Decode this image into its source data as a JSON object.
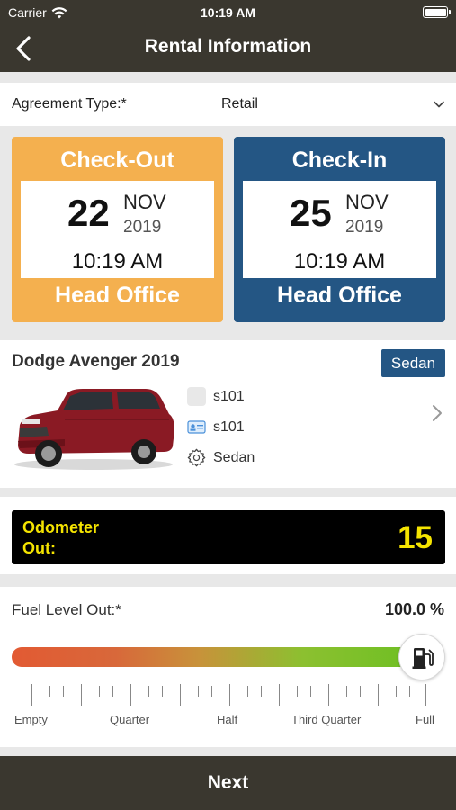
{
  "status_bar": {
    "carrier": "Carrier",
    "time": "10:19 AM"
  },
  "header": {
    "title": "Rental Information",
    "back_icon": "chevron-left-icon"
  },
  "agreement": {
    "label": "Agreement Type:*",
    "value": "Retail"
  },
  "checkout": {
    "title": "Check-Out",
    "day": "22",
    "month": "NOV",
    "year": "2019",
    "time": "10:19 AM",
    "location": "Head Office",
    "color": "#f4b04f"
  },
  "checkin": {
    "title": "Check-In",
    "day": "25",
    "month": "NOV",
    "year": "2019",
    "time": "10:19 AM",
    "location": "Head Office",
    "color": "#245684"
  },
  "vehicle": {
    "name": "Dodge Avenger 2019",
    "type_badge": "Sedan",
    "specs": [
      {
        "icon": "square-placeholder-icon",
        "text": "s101"
      },
      {
        "icon": "id-card-icon",
        "text": "s101"
      },
      {
        "icon": "gear-icon",
        "text": "Sedan"
      }
    ]
  },
  "odometer": {
    "label": "Odometer Out:",
    "value": "15"
  },
  "fuel": {
    "label": "Fuel Level Out:*",
    "percent_text": "100.0 %",
    "level_fraction": 1.0,
    "scale_labels": [
      "Empty",
      "Quarter",
      "Half",
      "Third Quarter",
      "Full"
    ]
  },
  "footer": {
    "next_label": "Next"
  },
  "colors": {
    "bar": "#3a372f",
    "accent_orange": "#f4b04f",
    "accent_blue": "#245684",
    "odo_text": "#f5e400"
  }
}
